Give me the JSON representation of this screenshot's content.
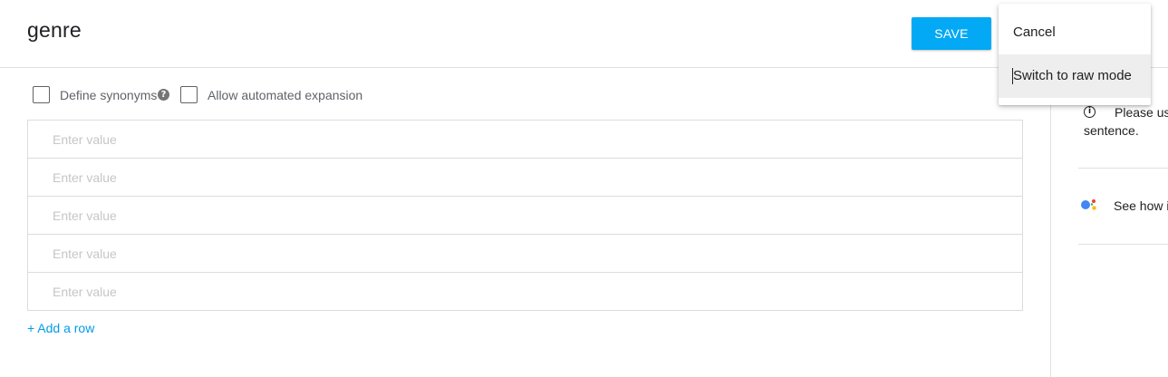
{
  "header": {
    "entity_name": "genre",
    "save_label": "SAVE"
  },
  "options": {
    "define_synonyms_label": "Define synonyms",
    "allow_expansion_label": "Allow automated expansion",
    "help_glyph": "?"
  },
  "values": {
    "rows": [
      {
        "value": "",
        "placeholder": "Enter value"
      },
      {
        "value": "",
        "placeholder": "Enter value"
      },
      {
        "value": "",
        "placeholder": "Enter value"
      },
      {
        "value": "",
        "placeholder": "Enter value"
      },
      {
        "value": "",
        "placeholder": "Enter value"
      }
    ],
    "add_row_label": "+ Add a row"
  },
  "menu": {
    "items": [
      {
        "label": "Cancel"
      },
      {
        "label": "Switch to raw mode"
      }
    ]
  },
  "side_panel": {
    "tip_line_1": "Please use",
    "tip_line_2": "sentence.",
    "assistant_text": "See how it"
  },
  "icons": {
    "info": "info-icon",
    "help": "help-icon",
    "assistant": "google-assistant-icon"
  },
  "colors": {
    "accent": "#03a9f4",
    "link": "#039be5",
    "assistant_blue": "#4285f4",
    "assistant_red": "#ea4335",
    "assistant_yellow": "#fbbc05",
    "assistant_green": "#34a853"
  }
}
